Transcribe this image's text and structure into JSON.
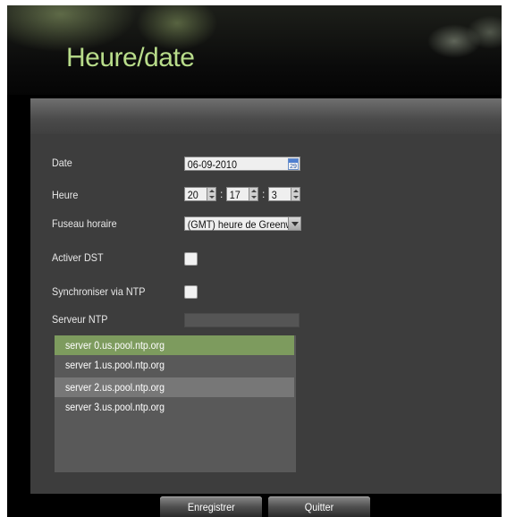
{
  "window": {
    "title": "Heure/date"
  },
  "form": {
    "date_label": "Date",
    "date_value": "06-09-2010",
    "calendar_icon_text": "29",
    "time_label": "Heure",
    "hour": "20",
    "minute": "17",
    "second": "3",
    "timezone_label": "Fuseau horaire",
    "timezone_value": "(GMT) heure de Greenwi",
    "dst_label": "Activer DST",
    "dst_checked": false,
    "ntp_sync_label": "Synchroniser via NTP",
    "ntp_sync_checked": false,
    "ntp_server_label": "Serveur NTP",
    "ntp_server_value": ""
  },
  "ntp_servers": [
    "server 0.us.pool.ntp.org",
    "server 1.us.pool.ntp.org",
    "server 2.us.pool.ntp.org",
    "server 3.us.pool.ntp.org"
  ],
  "buttons": {
    "save": "Enregistrer",
    "quit": "Quitter"
  },
  "colors": {
    "title": "#b8dc8a",
    "selected_row": "#7d9b5e",
    "hover_row": "#777777"
  }
}
